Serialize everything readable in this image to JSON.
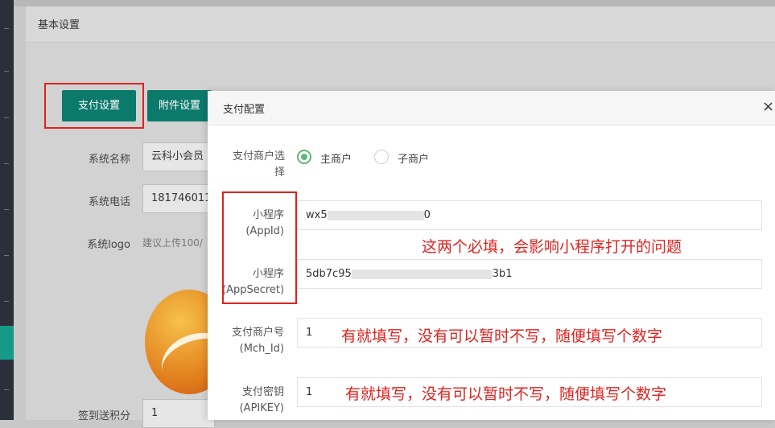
{
  "background": {
    "page_title": "基本设置",
    "tabs": [
      {
        "label": "支付设置"
      },
      {
        "label": "附件设置"
      }
    ],
    "fields": [
      {
        "label": "系统名称",
        "value": "云科小会员"
      },
      {
        "label": "系统电话",
        "value": "181746011"
      },
      {
        "label": "系统logo",
        "hint": "建议上传100/"
      },
      {
        "label": "签到送积分",
        "value": "1"
      }
    ]
  },
  "modal": {
    "title": "支付配置",
    "close_icon": "×",
    "merchant_type": {
      "label": "支付商户选择",
      "options": [
        {
          "label": "主商户",
          "selected": true
        },
        {
          "label": "子商户",
          "selected": false
        }
      ]
    },
    "fields": [
      {
        "label": "小程序\n(AppId)",
        "label_line1": "小程序",
        "label_line2": "(AppId)",
        "value_start": "wx5",
        "value_end": "0"
      },
      {
        "label_line1": "小程序",
        "label_line2": "(AppSecret)",
        "value_start": "5db7c95",
        "value_end": "3b1"
      },
      {
        "label_line1": "支付商户号",
        "label_line2": "(Mch_Id)",
        "value": "1"
      },
      {
        "label_line1": "支付密钥",
        "label_line2": "(APIKEY)",
        "value": "1"
      }
    ]
  },
  "annotations": {
    "required_note": "这两个必填，会影响小程序打开的问题",
    "optional_note_1": "有就填写，没有可以暂时不写，随便填写个数字",
    "optional_note_2": "有就填写，没有可以暂时不写，随便填写个数字"
  },
  "colors": {
    "accent": "#0c7a6b",
    "annotation_red": "#e0221f",
    "radio_green": "#5fb878"
  }
}
